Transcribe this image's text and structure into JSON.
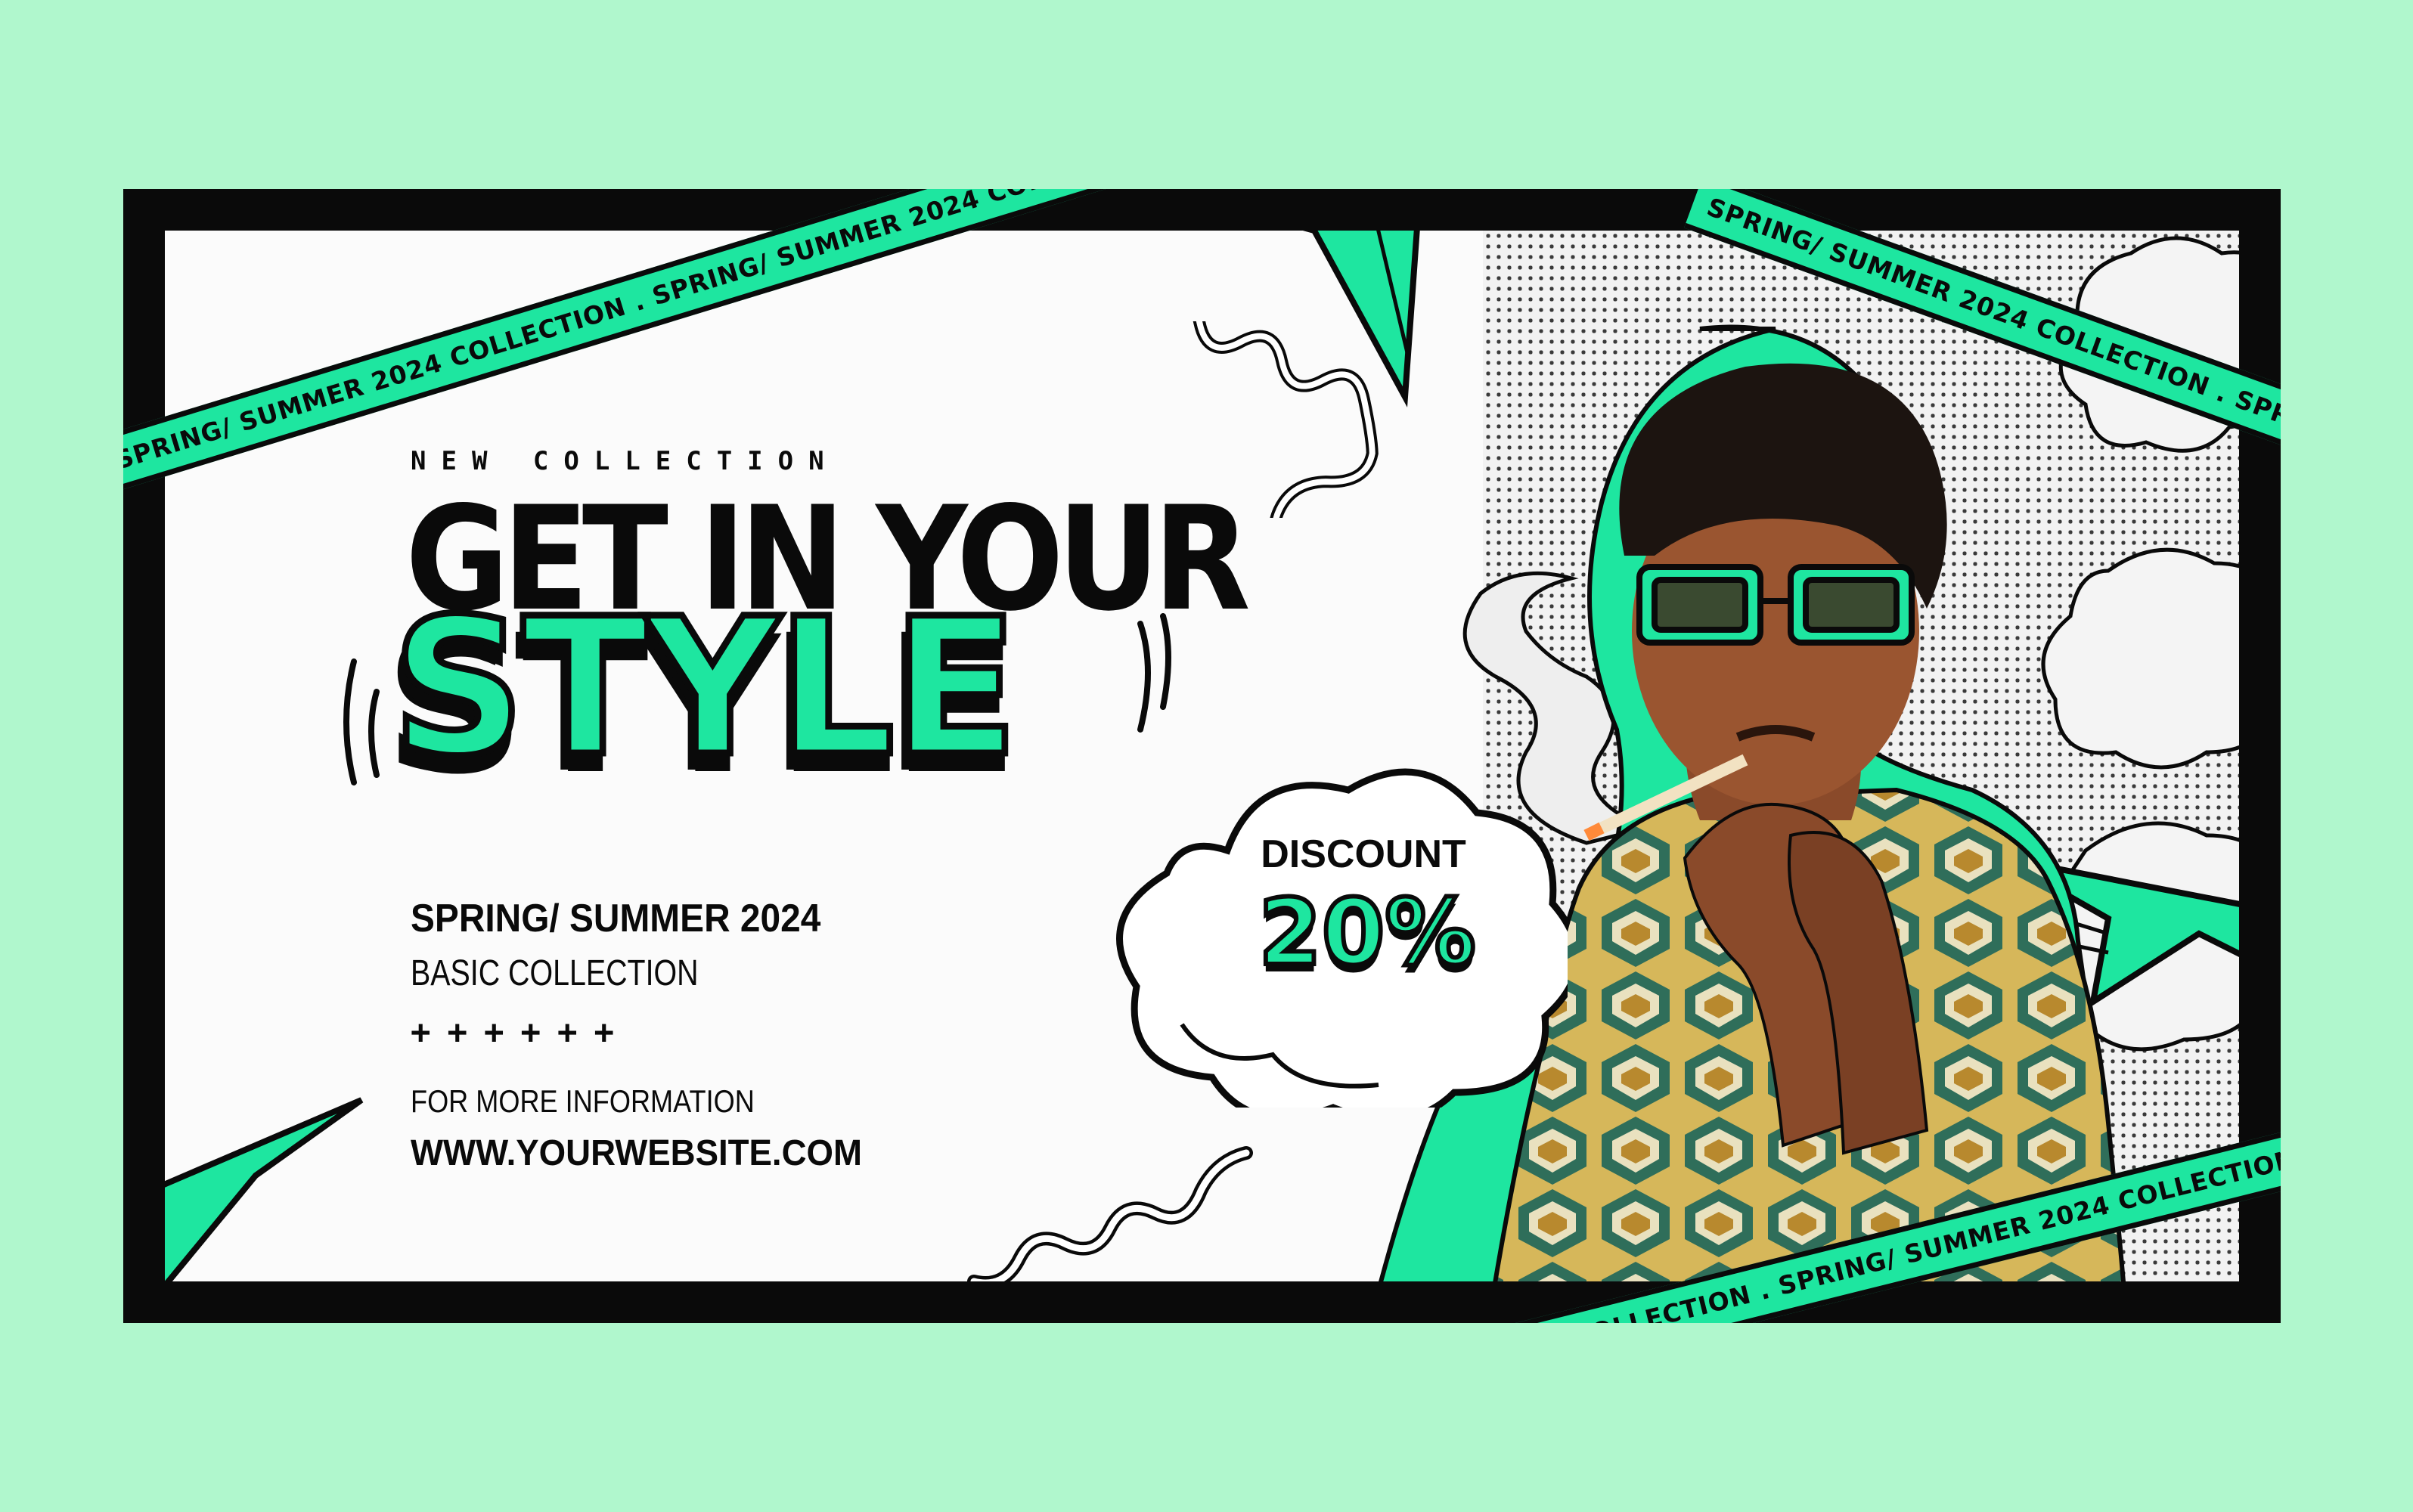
{
  "banner": {
    "eyebrow": "NEW COLLECTION",
    "headline": "GET IN YOUR",
    "highlight": "STYLE",
    "season": "SPRING/ SUMMER 2024",
    "collection": "BASIC COLLECTION",
    "plus_row": "++++++",
    "info_label": "FOR MORE INFORMATION",
    "website": "WWW.YOURWEBSITE.COM"
  },
  "badge": {
    "label": "DISCOUNT",
    "value": "20%"
  },
  "tape_text": "SPRING/ SUMMER 2024 COLLECTION . SPRING/ SUMMER 2024 COLLECTION . SPRING/ SUMMER 2024 COLLECTION .",
  "colors": {
    "background": "#b0f7cd",
    "accent": "#1ee6a0",
    "ink": "#0a0a0a",
    "paper": "#fbfbfb"
  }
}
